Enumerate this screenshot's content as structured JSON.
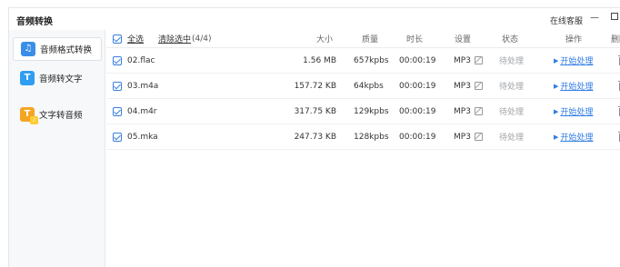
{
  "window": {
    "title": "音频转换",
    "online_service": "在线客服",
    "minimize": "—"
  },
  "sidebar": {
    "items": [
      {
        "label": "音频格式转换",
        "icon": "music-note-icon",
        "active": true
      },
      {
        "label": "音频转文字",
        "icon": "text-T-icon",
        "active": false
      },
      {
        "label": "文字转音频",
        "icon": "audio-convert-icon",
        "active": false
      }
    ]
  },
  "table": {
    "select_all": "全选",
    "clear_selected": "清除选中",
    "count": "(4/4)",
    "columns": {
      "size": "大小",
      "quality": "质量",
      "duration": "时长",
      "settings": "设置",
      "status": "状态",
      "action": "操作",
      "delete": "删除"
    },
    "rows": [
      {
        "name": "02.flac",
        "size": "1.56 MB",
        "quality": "657kpbs",
        "duration": "00:00:19",
        "format": "MP3",
        "status": "待处理",
        "action": "开始处理"
      },
      {
        "name": "03.m4a",
        "size": "157.72 KB",
        "quality": "64kpbs",
        "duration": "00:00:19",
        "format": "MP3",
        "status": "待处理",
        "action": "开始处理"
      },
      {
        "name": "04.m4r",
        "size": "317.75 KB",
        "quality": "129kpbs",
        "duration": "00:00:19",
        "format": "MP3",
        "status": "待处理",
        "action": "开始处理"
      },
      {
        "name": "05.mka",
        "size": "247.73 KB",
        "quality": "128kpbs",
        "duration": "00:00:19",
        "format": "MP3",
        "status": "待处理",
        "action": "开始处理"
      }
    ]
  }
}
